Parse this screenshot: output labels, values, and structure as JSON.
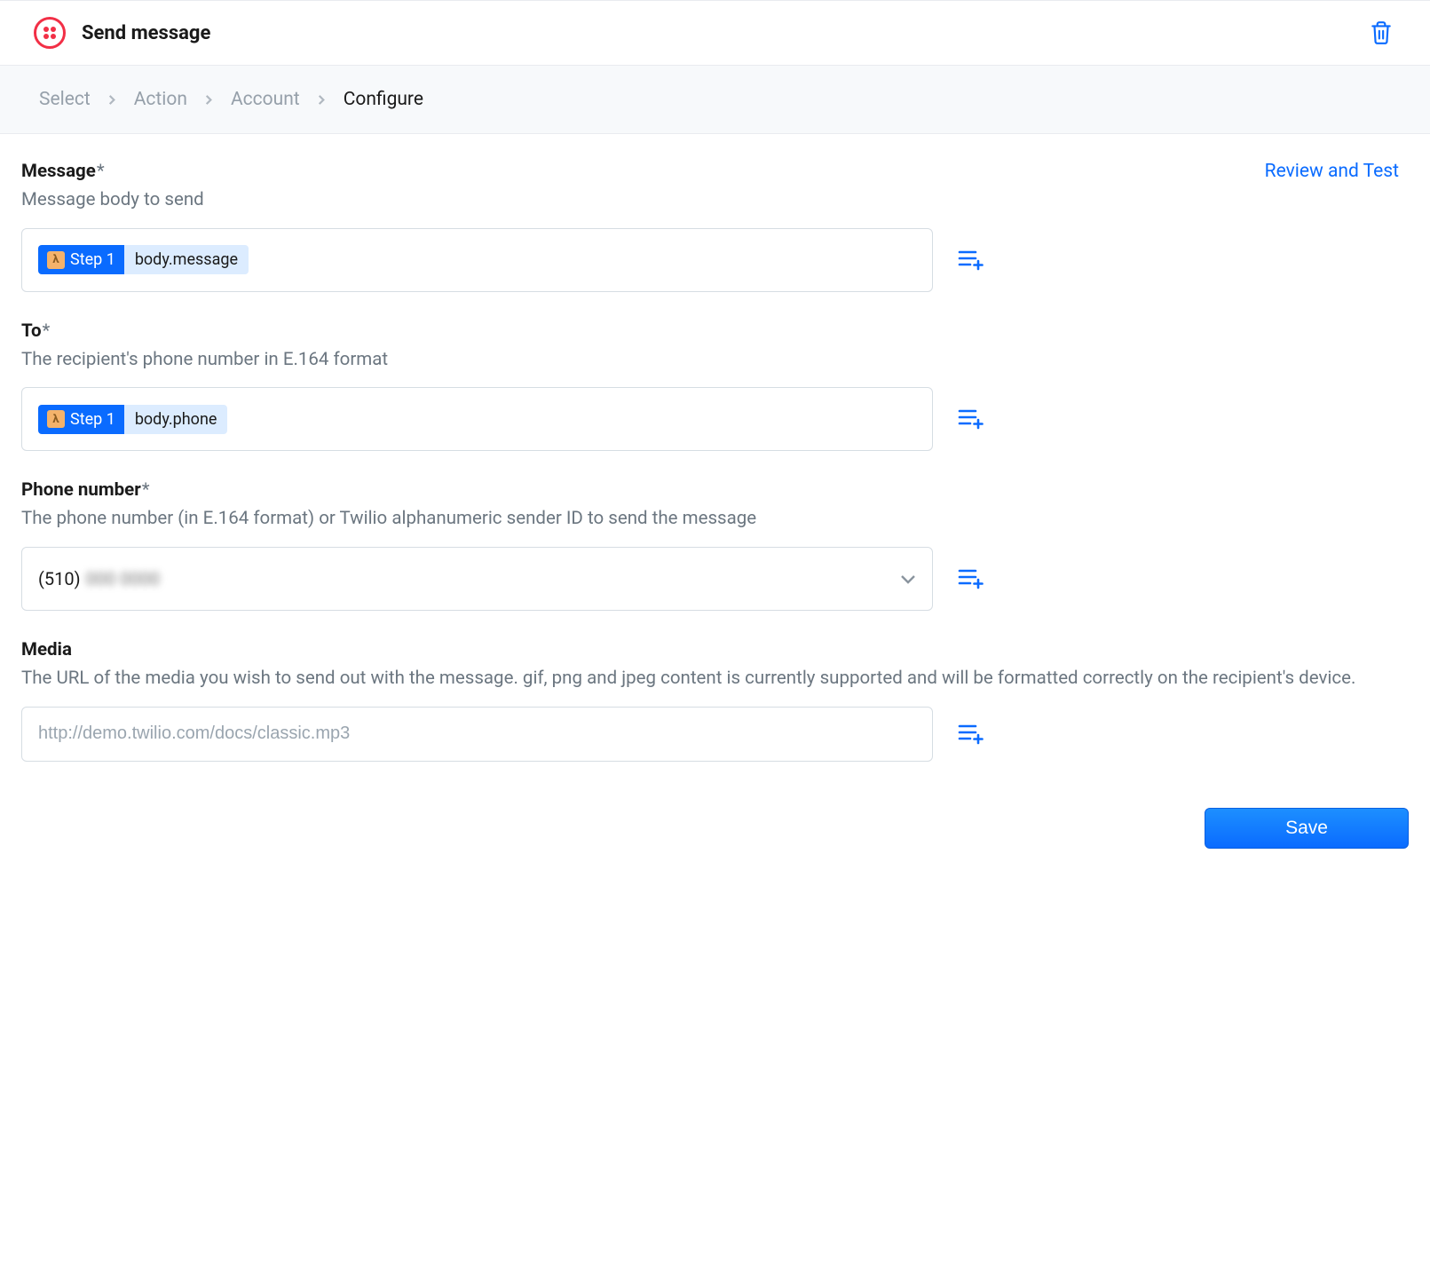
{
  "header": {
    "title": "Send message"
  },
  "breadcrumb": {
    "items": [
      "Select",
      "Action",
      "Account",
      "Configure"
    ],
    "active_index": 3
  },
  "review_link": "Review and Test",
  "fields": {
    "message": {
      "label": "Message",
      "required": true,
      "description": "Message body to send",
      "token_step": "Step 1",
      "token_path": "body.message"
    },
    "to": {
      "label": "To",
      "required": true,
      "description": "The recipient's phone number in E.164 format",
      "token_step": "Step 1",
      "token_path": "body.phone"
    },
    "phone_number": {
      "label": "Phone number",
      "required": true,
      "description": "The phone number (in E.164 format) or Twilio alphanumeric sender ID to send the message",
      "value_prefix": "(510)",
      "value_hidden": "000 0000"
    },
    "media": {
      "label": "Media",
      "required": false,
      "description": "The URL of the media you wish to send out with the message. gif, png and jpeg content is currently supported and will be formatted correctly on the recipient's device.",
      "placeholder": "http://demo.twilio.com/docs/classic.mp3",
      "value": ""
    }
  },
  "footer": {
    "save_label": "Save"
  },
  "icons": {
    "trash": "trash-icon",
    "chevron_right": "chevron-right-icon",
    "chevron_down": "chevron-down-icon",
    "insert_variable": "insert-variable-icon",
    "lambda": "λ"
  },
  "colors": {
    "accent_blue": "#0a6bff",
    "brand_red": "#f22f46",
    "muted_text": "#6b7680"
  }
}
